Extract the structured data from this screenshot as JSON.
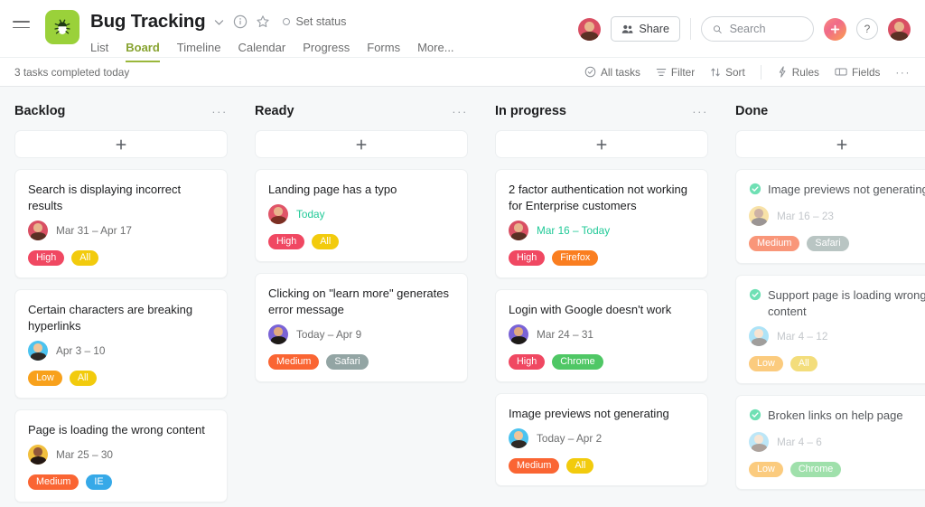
{
  "header": {
    "project_title": "Bug Tracking",
    "set_status_label": "Set status",
    "icons": {
      "menu": "hamburger-icon",
      "project": "bug-icon",
      "dropdown": "chevron-down-icon",
      "info": "info-circle-icon",
      "favorite": "star-icon",
      "status": "status-circle-icon"
    },
    "tabs": [
      {
        "label": "List",
        "active": false
      },
      {
        "label": "Board",
        "active": true
      },
      {
        "label": "Timeline",
        "active": false
      },
      {
        "label": "Calendar",
        "active": false
      },
      {
        "label": "Progress",
        "active": false
      },
      {
        "label": "Forms",
        "active": false
      },
      {
        "label": "More...",
        "active": false
      }
    ],
    "share_label": "Share",
    "search": {
      "placeholder": "Search",
      "value": ""
    },
    "help_label": "?",
    "plus_label": "+",
    "accent_green": "#9ad13a",
    "tab_active_color": "#87a330"
  },
  "subbar": {
    "status_text": "3 tasks completed today",
    "actions": [
      {
        "label": "All tasks",
        "icon": "check-circle-icon"
      },
      {
        "label": "Filter",
        "icon": "filter-icon"
      },
      {
        "label": "Sort",
        "icon": "sort-icon"
      },
      {
        "label": "Rules",
        "icon": "lightning-icon"
      },
      {
        "label": "Fields",
        "icon": "fields-icon"
      }
    ],
    "overflow_label": "···"
  },
  "board": {
    "add_label": "+",
    "column_menu_label": "···",
    "columns": [
      {
        "name": "Backlog",
        "has_menu": true,
        "cards": [
          {
            "title": "Search is displaying incorrect results",
            "date": "Mar 31 – Apr 17",
            "date_today": false,
            "done": false,
            "avatar": {
              "skin": "#e8b48c",
              "hair": "#5b3024",
              "shirt": "#c9485d",
              "ring": "#d94f63"
            },
            "tags": [
              {
                "label": "High",
                "color": "#f04862"
              },
              {
                "label": "All",
                "color": "#f2cb0d"
              }
            ]
          },
          {
            "title": "Certain characters are breaking hyperlinks",
            "date": "Apr 3 – 10",
            "date_today": false,
            "done": false,
            "avatar": {
              "skin": "#f0c59a",
              "hair": "#2f2a26",
              "shirt": "#3bb4e5",
              "ring": "#4cc3ef"
            },
            "tags": [
              {
                "label": "Low",
                "color": "#f8a11c"
              },
              {
                "label": "All",
                "color": "#f2cb0d"
              }
            ]
          },
          {
            "title": "Page is loading the wrong content",
            "date": "Mar 25 – 30",
            "date_today": false,
            "done": false,
            "avatar": {
              "skin": "#92573a",
              "hair": "#231713",
              "shirt": "#f4c542",
              "ring": "#f1bf3d"
            },
            "tags": [
              {
                "label": "Medium",
                "color": "#fa6533"
              },
              {
                "label": "IE",
                "color": "#36a9e8"
              }
            ]
          }
        ]
      },
      {
        "name": "Ready",
        "has_menu": true,
        "cards": [
          {
            "title": "Landing page has a typo",
            "date": "Today",
            "date_today": true,
            "done": false,
            "avatar": {
              "skin": "#e8b48c",
              "hair": "#7b2f23",
              "shirt": "#d94f63",
              "ring": "#e05568"
            },
            "tags": [
              {
                "label": "High",
                "color": "#f04862"
              },
              {
                "label": "All",
                "color": "#f2cb0d"
              }
            ]
          },
          {
            "title": "Clicking on \"learn more\" generates error message",
            "date": "Today – Apr 9",
            "date_today": false,
            "done": false,
            "avatar": {
              "skin": "#e0a97e",
              "hair": "#1d1a17",
              "shirt": "#6d5bc9",
              "ring": "#7a63d6"
            },
            "tags": [
              {
                "label": "Medium",
                "color": "#fa6533"
              },
              {
                "label": "Safari",
                "color": "#93a5a4"
              }
            ]
          }
        ]
      },
      {
        "name": "In progress",
        "has_menu": true,
        "cards": [
          {
            "title": "2 factor authentication not working for Enterprise customers",
            "date": "Mar 16 – Today",
            "date_today": true,
            "done": false,
            "avatar": {
              "skin": "#e8b48c",
              "hair": "#5b3024",
              "shirt": "#c9485d",
              "ring": "#d94f63"
            },
            "tags": [
              {
                "label": "High",
                "color": "#f04862"
              },
              {
                "label": "Firefox",
                "color": "#fa7e20"
              }
            ]
          },
          {
            "title": "Login with Google doesn't work",
            "date": "Mar 24 – 31",
            "date_today": false,
            "done": false,
            "avatar": {
              "skin": "#e0a97e",
              "hair": "#1d1a17",
              "shirt": "#6d5bc9",
              "ring": "#7a63d6"
            },
            "tags": [
              {
                "label": "High",
                "color": "#f04862"
              },
              {
                "label": "Chrome",
                "color": "#4fc765"
              }
            ]
          },
          {
            "title": "Image previews not generating",
            "date": "Today – Apr 2",
            "date_today": false,
            "done": false,
            "avatar": {
              "skin": "#f0c59a",
              "hair": "#2f2a26",
              "shirt": "#3bb4e5",
              "ring": "#4cc3ef"
            },
            "tags": [
              {
                "label": "Medium",
                "color": "#fa6533"
              },
              {
                "label": "All",
                "color": "#f2cb0d"
              }
            ]
          }
        ]
      },
      {
        "name": "Done",
        "has_menu": false,
        "cards": [
          {
            "title": "Image previews not generating",
            "date": "Mar 16 – 23",
            "date_today": false,
            "done": true,
            "avatar": {
              "skin": "#92573a",
              "hair": "#231713",
              "shirt": "#f4c542",
              "ring": "#f1bf3d"
            },
            "tags": [
              {
                "label": "Medium",
                "color": "#f99679"
              },
              {
                "label": "Safari",
                "color": "#b9c5c3"
              }
            ]
          },
          {
            "title": "Support page is loading wrong content",
            "date": "Mar 4 – 12",
            "date_today": false,
            "done": true,
            "avatar": {
              "skin": "#f0c59a",
              "hair": "#2f2a26",
              "shirt": "#3bb4e5",
              "ring": "#4cc3ef"
            },
            "tags": [
              {
                "label": "Low",
                "color": "#fbcb7e"
              },
              {
                "label": "All",
                "color": "#f3dd7b"
              }
            ]
          },
          {
            "title": "Broken links on help page",
            "date": "Mar 4 – 6",
            "date_today": false,
            "done": true,
            "avatar": {
              "skin": "#eec9a5",
              "hair": "#4b3326",
              "shirt": "#5ec0ea",
              "ring": "#6cc9ef"
            },
            "tags": [
              {
                "label": "Low",
                "color": "#fbcb7e"
              },
              {
                "label": "Chrome",
                "color": "#9fe0ab"
              }
            ]
          }
        ]
      }
    ]
  }
}
